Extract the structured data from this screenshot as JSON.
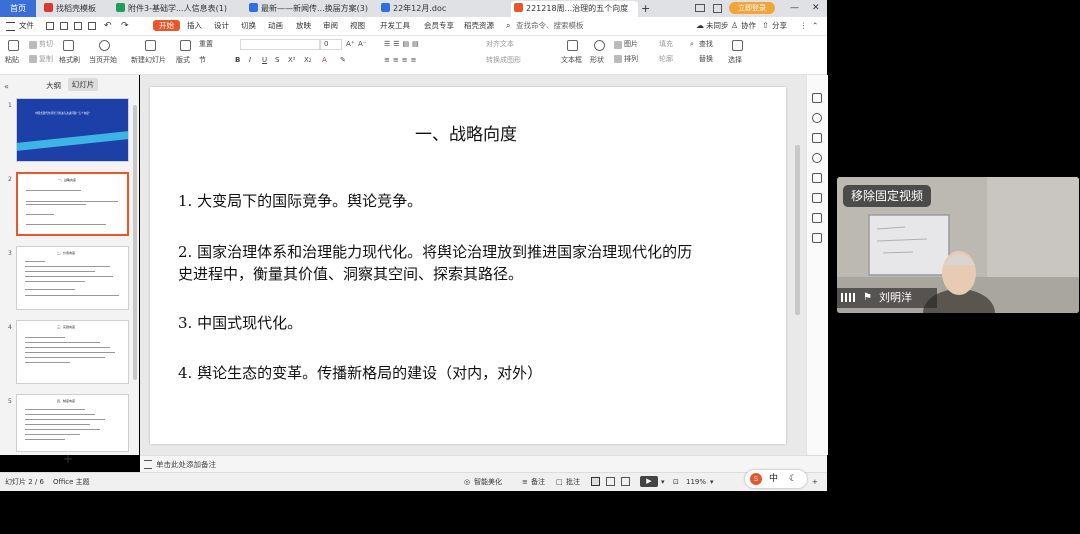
{
  "tabs": {
    "home": "首页",
    "items": [
      "找稻壳模板",
      "附件3-基础学...人信息表(1)",
      "最新——新闻传...换届方案(3)",
      "22年12月.doc",
      "221218周...治理的五个向度"
    ],
    "add": "+",
    "login": "立即登录",
    "win_min": "—",
    "win_close": "✕"
  },
  "menu": {
    "file": "文件",
    "items": [
      "开始",
      "插入",
      "设计",
      "切换",
      "动画",
      "放映",
      "审阅",
      "视图",
      "开发工具",
      "会员专享",
      "稻壳资源"
    ],
    "search_placeholder": "查找命令、搜索模板",
    "sync": "未同步",
    "collab": "协作",
    "share": "分享"
  },
  "ribbon": {
    "paste": "粘贴",
    "cut": "剪切",
    "copy": "复制",
    "format_painter": "格式刷",
    "from_current": "当页开始",
    "new_slide": "新建幻灯片",
    "layout": "版式",
    "section": "节",
    "reset": "重置",
    "font_size": "0",
    "textbox": "文本框",
    "shape": "形状",
    "arrange": "排列",
    "outline": "轮廓",
    "picture": "图片",
    "fill": "填充",
    "find": "查找",
    "replace": "替换",
    "select": "选择",
    "convert_smartart": "转换成图形",
    "text_direction": "对齐文本"
  },
  "left_panel": {
    "outline_tab": "大纲",
    "slides_tab": "幻灯片",
    "numbers": [
      "1",
      "2",
      "3",
      "4",
      "5"
    ],
    "thumb1_title": "中国式现代化背景下推进与改进问题 \"五个向度\"",
    "thumb2_title": "一、战略向度",
    "thumb3_title": "二、价值向度",
    "thumb4_title": "三、实践向度",
    "thumb5_title": "四、制度向度",
    "add": "+"
  },
  "slide": {
    "title": "一、战略向度",
    "p1": "1. 大变局下的国际竞争。舆论竞争。",
    "p2_line1": "2. 国家治理体系和治理能力现代化。将舆论治理放到推进国家治理现代化的历",
    "p2_line2": "史进程中，衡量其价值、洞察其空间、探索其路径。",
    "p3": "3. 中国式现代化。",
    "p4": "4. 舆论生态的变革。传播新格局的建设（对内，对外）"
  },
  "notes": {
    "placeholder": "单击此处添加备注"
  },
  "status": {
    "slide_count": "幻灯片 2 / 6",
    "theme": "Office 主题",
    "beautify": "智能美化",
    "notes": "备注",
    "comment": "批注",
    "zoom": "119%"
  },
  "ime": {
    "mode": "中"
  },
  "video": {
    "remove_button": "移除固定视频",
    "name": "刘明洋"
  }
}
